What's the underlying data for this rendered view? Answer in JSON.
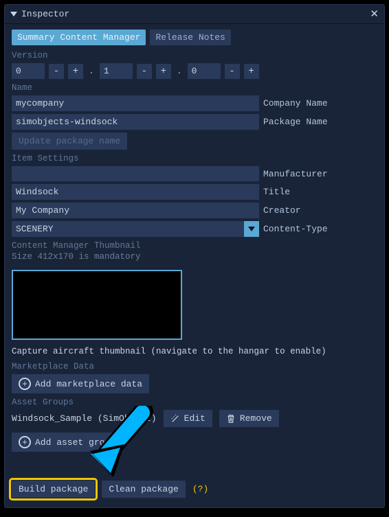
{
  "window": {
    "title": "Inspector"
  },
  "tabs": {
    "active": "Summary Content Manager",
    "other": "Release Notes"
  },
  "version": {
    "label": "Version",
    "major": "0",
    "minor": "1",
    "patch": "0"
  },
  "name": {
    "label": "Name",
    "company_value": "mycompany",
    "company_label": "Company Name",
    "package_value": "simobjects-windsock",
    "package_label": "Package Name",
    "update_btn": "Update package name"
  },
  "item": {
    "label": "Item Settings",
    "manufacturer_value": "",
    "manufacturer_label": "Manufacturer",
    "title_value": "Windsock",
    "title_label": "Title",
    "creator_value": "My Company",
    "creator_label": "Creator",
    "content_type_value": "SCENERY",
    "content_type_label": "Content-Type"
  },
  "thumb": {
    "label": "Content Manager Thumbnail",
    "hint": "Size 412x170 is mandatory",
    "caption": "Capture aircraft thumbnail (navigate to the hangar to enable)"
  },
  "marketplace": {
    "label": "Marketplace Data",
    "add_btn": "Add marketplace data"
  },
  "assets": {
    "label": "Asset Groups",
    "item0": "Windsock_Sample (SimObject)",
    "edit": "Edit",
    "remove": "Remove",
    "add_btn": "Add asset group"
  },
  "build": {
    "build": "Build package",
    "clean": "Clean package",
    "help": "(?)"
  }
}
